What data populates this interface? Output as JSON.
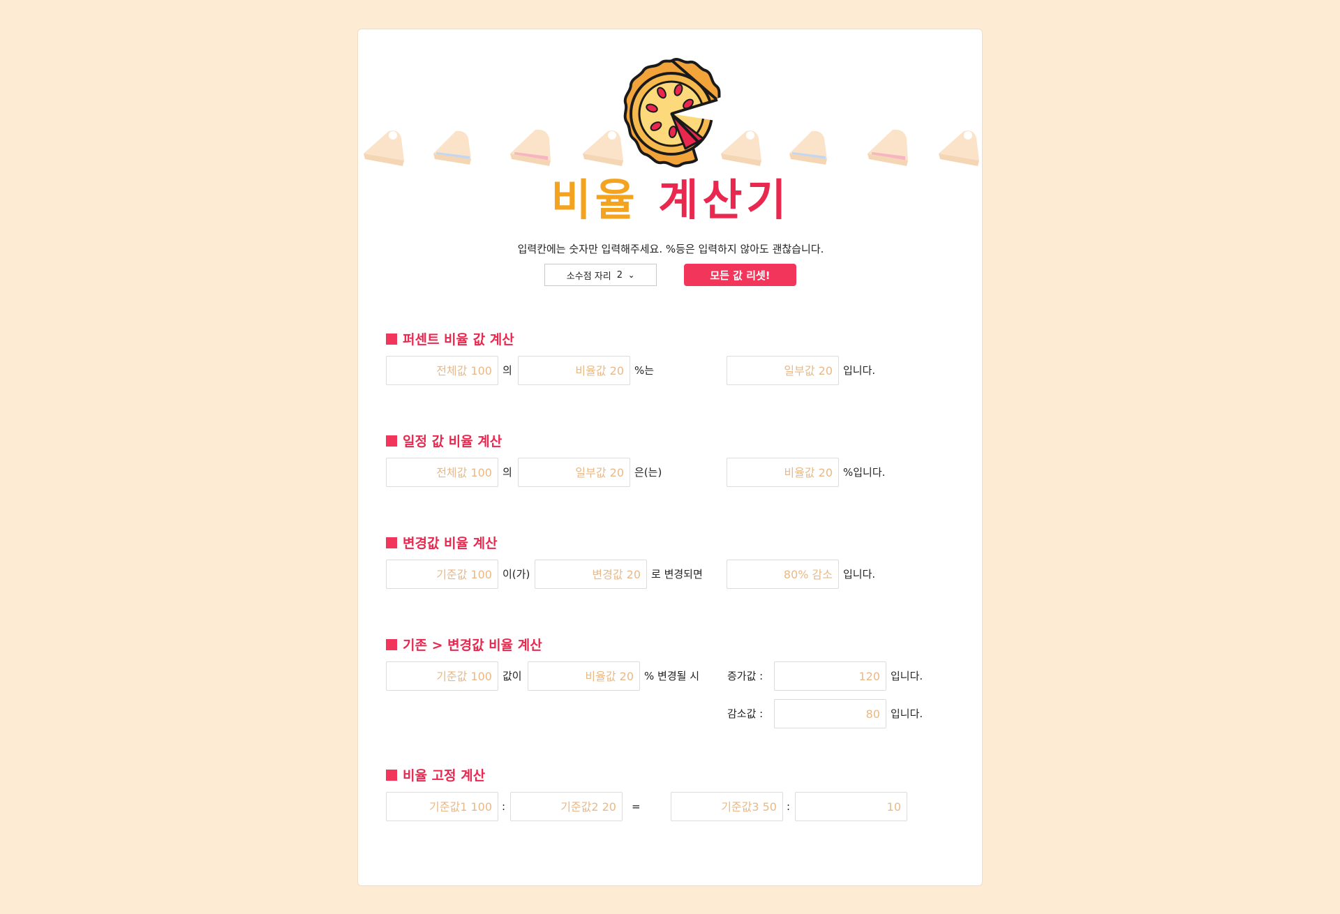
{
  "header": {
    "title_part1": "비율",
    "title_part2": "계산기",
    "notice": "입력칸에는 숫자만 입력해주세요. %등은 입력하지 않아도 괜찮습니다.",
    "decimal_label": "소수점 자리",
    "decimal_value": "2",
    "reset_label": "모든 값 리셋!"
  },
  "colors": {
    "accent": "#f2355a",
    "title_orange": "#f4a320",
    "title_red": "#e8284f",
    "background": "#fdebd3",
    "placeholder": "#e8b987"
  },
  "sections": {
    "percent": {
      "title": "퍼센트 비율 값 계산",
      "total_placeholder": "전체값 100",
      "of": "의",
      "rate_placeholder": "비율값 20",
      "pct_is": "%는",
      "part_placeholder": "일부값 20",
      "is": "입니다."
    },
    "part": {
      "title": "일정 값 비율 계산",
      "total_placeholder": "전체값 100",
      "of": "의",
      "part_placeholder": "일부값 20",
      "is_topic": "은(는)",
      "rate_placeholder": "비율값 20",
      "pct_is": "%입니다."
    },
    "change": {
      "title": "변경값 비율 계산",
      "base_placeholder": "기준값 100",
      "subj": "이(가)",
      "changed_placeholder": "변경값 20",
      "when_changed": "로 변경되면",
      "result_placeholder": "80% 감소",
      "is": "입니다."
    },
    "base_change": {
      "title": "기존 > 변경값 비율 계산",
      "base_placeholder": "기준값 100",
      "value_subj": "값이",
      "rate_placeholder": "비율값 20",
      "pct_when": "% 변경될 시",
      "inc_label": "증가값 :",
      "inc_placeholder": "120",
      "dec_label": "감소값 :",
      "dec_placeholder": "80",
      "is": "입니다."
    },
    "fixed": {
      "title": "비율 고정 계산",
      "b1_placeholder": "기준값1 100",
      "colon": ":",
      "b2_placeholder": "기준값2 20",
      "equals": "=",
      "b3_placeholder": "기준값3 50",
      "result_placeholder": "10"
    }
  },
  "icons": [
    "pie-logo-icon",
    "pie-slice-icon"
  ]
}
